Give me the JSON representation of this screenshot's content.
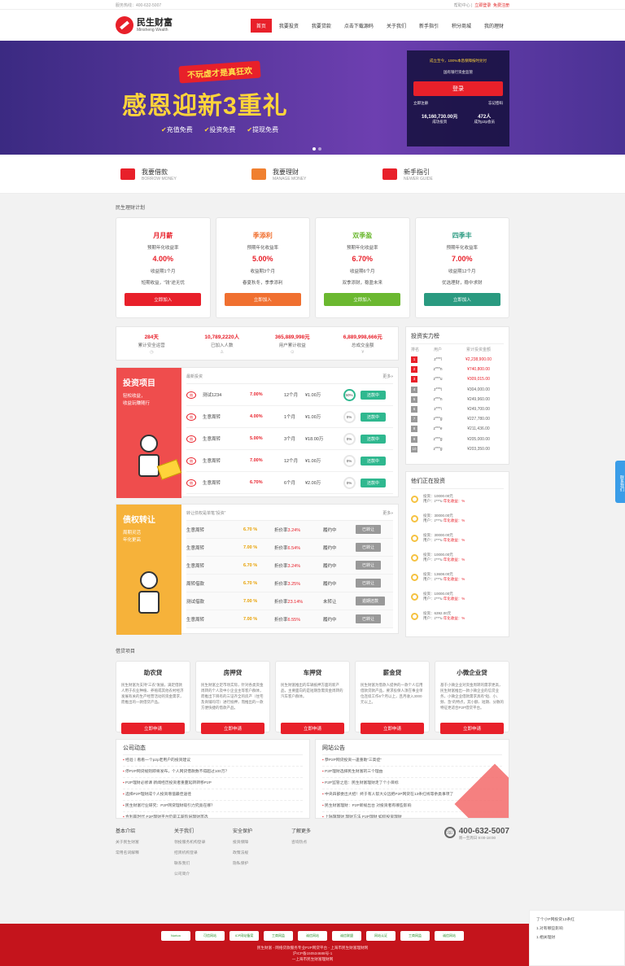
{
  "topbar": {
    "hotline": "服务热线：400-632-5007",
    "right": "帮助中心",
    "login": "立即登录",
    "register": "免费注册"
  },
  "header": {
    "logo_cn": "民生财富",
    "logo_en": "Minsheng Wealth",
    "nav": [
      "首页",
      "我要投资",
      "我要贷款",
      "点击下载源码",
      "关于我们",
      "新手指引",
      "积分商城",
      "我的理财"
    ]
  },
  "banner": {
    "subtitle": "不玩虚才是真狂欢",
    "title": "感恩迎新3重礼",
    "tags": [
      "充值免费",
      "投资免费",
      "提现免费"
    ],
    "login": {
      "line1": "成立至今，100%本息保障按时兑付",
      "line2": "国有银行资金监管",
      "button": "登录",
      "reg": "立即注册",
      "forgot": "忘记密码",
      "stat1": "16,160,730.00元",
      "stat1_label": "成功投资",
      "stat2": "472人",
      "stat2_label": "成为p2p会员"
    }
  },
  "quick": [
    {
      "title": "我要借款",
      "en": "BORROW MONEY",
      "color": "#e8202a"
    },
    {
      "title": "我要理财",
      "en": "MANAGE MONEY",
      "color": "#f08030"
    },
    {
      "title": "新手指引",
      "en": "NEWER GUIDE",
      "color": "#e8202a"
    }
  ],
  "plan_title": "民生理财计划",
  "products": [
    {
      "name": "月月薪",
      "label": "预期年化收益率",
      "rate": "4.00%",
      "period": "收益期1个月",
      "desc": "短期收益，“钱”途无忧",
      "btn": "立即加入",
      "color": "#e8202a"
    },
    {
      "name": "季添利",
      "label": "预期年化收益率",
      "rate": "5.00%",
      "period": "收益期3个月",
      "desc": "春夏秋冬，季季添利",
      "btn": "立即加入",
      "color": "#f07030"
    },
    {
      "name": "双季盈",
      "label": "预期年化收益率",
      "rate": "6.70%",
      "period": "收益期6个月",
      "desc": "双季添财，稳盈未来",
      "btn": "立即加入",
      "color": "#6bb830"
    },
    {
      "name": "四季丰",
      "label": "预期年化收益率",
      "rate": "7.00%",
      "period": "收益期12个月",
      "desc": "优选理财，稳中求财",
      "btn": "立即加入",
      "color": "#2a9a80"
    }
  ],
  "stats": [
    {
      "v": "284天",
      "l": "累计安全运营"
    },
    {
      "v": "10,789,2220人",
      "l": "已加入人数"
    },
    {
      "v": "365,889,998元",
      "l": "用户累计收益"
    },
    {
      "v": "6,889,998,666元",
      "l": "总成交金额"
    }
  ],
  "invest": {
    "title": "投资项目",
    "sub1": "轻松收益，",
    "sub2": "收益玩赚随行",
    "head": "最新投资",
    "more": "更多»",
    "rows": [
      {
        "tag": "借",
        "name": "测试1234",
        "rate": "7.00%",
        "term": "12个月",
        "amt": "¥1.00万",
        "pct": "50%",
        "btn": "还款中"
      },
      {
        "tag": "借",
        "name": "生意周转",
        "rate": "4.00%",
        "term": "1个月",
        "amt": "¥1.00万",
        "pct": "0%",
        "btn": "还款中"
      },
      {
        "tag": "借",
        "name": "生意周转",
        "rate": "5.00%",
        "term": "3个月",
        "amt": "¥18.00万",
        "pct": "0%",
        "btn": "还款中"
      },
      {
        "tag": "借",
        "name": "生意周转",
        "rate": "7.00%",
        "term": "12个月",
        "amt": "¥1.00万",
        "pct": "0%",
        "btn": "还款中"
      },
      {
        "tag": "借",
        "name": "生意周转",
        "rate": "6.70%",
        "term": "6个月",
        "amt": "¥2.00万",
        "pct": "0%",
        "btn": "还款中"
      }
    ]
  },
  "transfer": {
    "title": "债权转让",
    "sub1": "周期灵活",
    "sub2": "年化更高",
    "head": "转让债权是单笔“投资”",
    "more": "更多»",
    "rows": [
      {
        "name": "生意周转",
        "rate": "6.70 %",
        "disc": "3.24%",
        "status": "履约中",
        "btn": "已转让"
      },
      {
        "name": "生意周转",
        "rate": "7.00 %",
        "disc": "6.54%",
        "status": "履约中",
        "btn": "已转让"
      },
      {
        "name": "生意周转",
        "rate": "6.70 %",
        "disc": "3.24%",
        "status": "履约中",
        "btn": "已转让"
      },
      {
        "name": "周转借款",
        "rate": "6.70 %",
        "disc": "3.25%",
        "status": "履约中",
        "btn": "已转让"
      },
      {
        "name": "测试借款",
        "rate": "7.00 %",
        "disc": "23.14%",
        "status": "未转让",
        "btn": "逾期还款"
      },
      {
        "name": "生意周转",
        "rate": "7.00 %",
        "disc": "6.55%",
        "status": "履约中",
        "btn": "已转让"
      }
    ],
    "disc_label": "折价率"
  },
  "ranking": {
    "title": "投资实力榜",
    "h": [
      "排名",
      "用户",
      "累计投资金额"
    ],
    "rows": [
      [
        "1",
        "z***l",
        "¥2,238,900.00"
      ],
      [
        "2",
        "z***n",
        "¥740,800.00"
      ],
      [
        "3",
        "z***u",
        "¥309,015.00"
      ],
      [
        "4",
        "z***t",
        "¥304,000.00"
      ],
      [
        "5",
        "z***n",
        "¥249,960.00"
      ],
      [
        "6",
        "z***i",
        "¥249,700.00"
      ],
      [
        "7",
        "z***g",
        "¥227,780.00"
      ],
      [
        "8",
        "z***e",
        "¥211,436.00"
      ],
      [
        "9",
        "z***g",
        "¥205,000.00"
      ],
      [
        "10",
        "z***g",
        "¥203,350.00"
      ]
    ]
  },
  "live": {
    "title": "他们正在投资",
    "items": [
      {
        "amt": "投资：10000.00元",
        "user": "用户：z***u",
        "rate": "年化收益：%"
      },
      {
        "amt": "投资：30000.00元",
        "user": "用户：z***u",
        "rate": "年化收益：%"
      },
      {
        "amt": "投资：30000.00元",
        "user": "用户：z***u",
        "rate": "年化收益：%"
      },
      {
        "amt": "投资：10000.00元",
        "user": "用户：z***u",
        "rate": "年化收益：%"
      },
      {
        "amt": "投资：13608.00元",
        "user": "用户：z***u",
        "rate": "年化收益：%"
      },
      {
        "amt": "投资：10000.00元",
        "user": "用户：z***u",
        "rate": "年化收益：%"
      },
      {
        "amt": "投资：6392.00元",
        "user": "用户：z***u",
        "rate": "年化收益：%"
      }
    ]
  },
  "loan_title": "借贷项目",
  "loans": [
    {
      "name": "助农贷",
      "desc": "民生财富为支持“三农”发展，满足借款人用于农业种植、养殖或其他农村经济发展有关的生产经营活动的资金需求，而推出的一款借贷产品。",
      "btn": "立即申请"
    },
    {
      "name": "房押贷",
      "desc": "民生财富立足市场实际，针对各类资金周转的个人及中小企业主等客户群体，而推出下目有的三证齐全的房产（住宅及商铺均可）进行抵押，而推出的一款方便快捷的借款产品。",
      "btn": "立即申请"
    },
    {
      "name": "车押贷",
      "desc": "民生财富推出的车辆抵押方面的新产品，主要面向的是短期急需资金周转的汽车客户群体。",
      "btn": "立即申请"
    },
    {
      "name": "薪金贷",
      "desc": "民生财富为借款人提供的一款个人信用借款贷款产品，要求投保人须在事业单位连续工作6个月以上，且月收入3000元以上。",
      "btn": "立即申请"
    },
    {
      "name": "小微企业贷",
      "desc": "基于小微企业对资金周转的需求更高，民生财富推出一款小微企业的信贷业务，小微企业借款需求具有“短、小、频、急”的特点，其小额、短期、分散的特征更适合P2P借贷平台。",
      "btn": "立即申请"
    }
  ],
  "company_news": {
    "title": "公司动态",
    "items": [
      "经验丨看看一个p2p老用户的投资建议",
      "停P2P网贷规则即将发布，个人网贷借款数不得超过100万？",
      "P2P理财必修课 新闻经历投资者重蔓延转转移P2P",
      "选择P2P理财成个人投资增值最佳途径",
      "民生财富行业研究：P2P网贷理财吸引力究竟在哪？",
      "合利率时代 P2P理财平台仍是工薪阶层理财首选"
    ]
  },
  "notices": {
    "title": "网站公告",
    "items": [
      "恭P2P网贷投资一逢重助“三高症”",
      "P2P理财选择民生财富的三个理由",
      "P2P监管之后：民生财富理财走了个小目标",
      "中央四部委出大招！终于有人帮大众远把P2P网贷在13条红线等余类事项了",
      "民生财富理财：P2P新规出台 对投资者有哪些影响",
      "上陆旗理财 理财方法 P2P理财 如何投资理财"
    ]
  },
  "footer": {
    "cols": [
      {
        "h": "基本介绍",
        "items": [
          "关于民生财富",
          "常用名词解释"
        ]
      },
      {
        "h": "关于我们",
        "items": [
          "领投服务机构登录",
          "招贤机构登录",
          "联系我们",
          "公司简介"
        ]
      },
      {
        "h": "安全保护",
        "items": [
          "投资保障",
          "政策法规",
          "隐私保护"
        ]
      },
      {
        "h": "了解更多",
        "items": [
          "咨询热点"
        ]
      }
    ],
    "phone": "400-632-5007",
    "hours": "周一至周日 9:00-18:00"
  },
  "bottom": {
    "badges": [
      "Norton",
      "可信网站",
      "ICP网站备案",
      "工商网监",
      "诚信网站",
      "诚信联盟",
      "网站认证",
      "工商网监",
      "诚信网站"
    ],
    "copy1": "民生财富 - 网络贷款服务专业P2P网贷平台 - 上海市民生财富理财网",
    "copy2": "沪ICP备150534688号-1",
    "copy3": "一上海市民生财富理财网"
  },
  "float": {
    "label": "联系我们"
  },
  "chat": {
    "l1": "了个小P网投贷13条红",
    "l2": "1.对有哪些影响",
    "l3": "1.相关理财"
  }
}
